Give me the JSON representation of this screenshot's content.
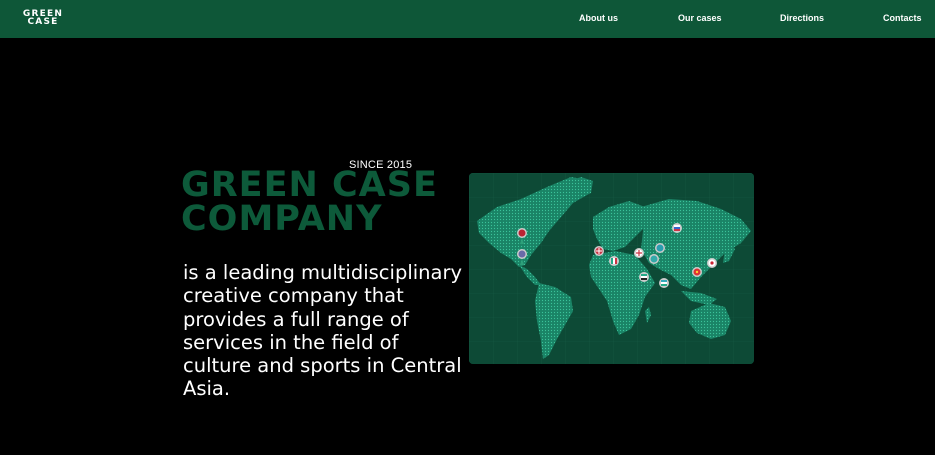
{
  "header": {
    "logo_line1": "GREEN",
    "logo_line2": "CASE",
    "nav": [
      {
        "label": "About us"
      },
      {
        "label": "Our cases"
      },
      {
        "label": "Directions"
      },
      {
        "label": "Contacts"
      }
    ],
    "bg_color": "#0e5738"
  },
  "hero": {
    "since": "SINCE 2015",
    "title_line1": "GREEN CASE",
    "title_line2": "COMPANY",
    "description": "is a leading multidisciplinary creative company that provides a full range of services in the field of culture and sports in Central Asia.",
    "title_color": "#0d5a3a"
  },
  "map": {
    "bg_color": "#0d4a36",
    "land_color": "#1b8a6c",
    "pins": [
      "us-flag-pin",
      "us-flag-pin-2",
      "uk-flag-pin",
      "italy-flag-pin",
      "georgia-flag-pin",
      "azerbaijan-flag-pin",
      "uae-flag-pin",
      "uzbekistan-flag-pin",
      "kazakhstan-flag-pin",
      "kyrgyzstan-flag-pin",
      "russia-flag-pin",
      "japan-flag-pin"
    ]
  }
}
